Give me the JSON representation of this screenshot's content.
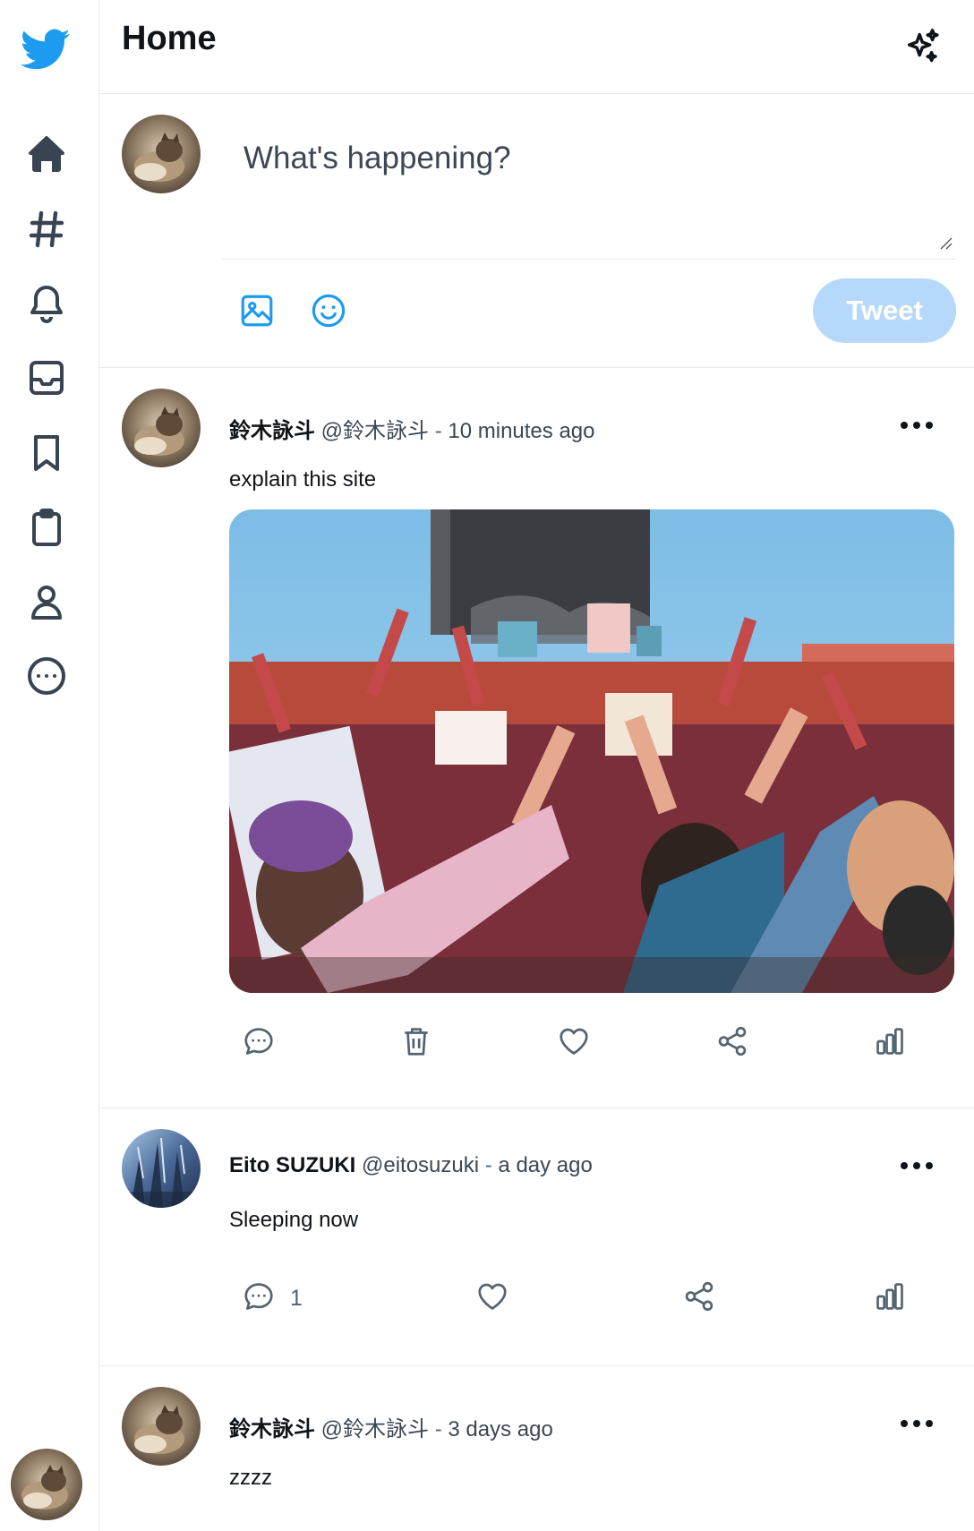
{
  "app": {
    "brand_color": "#1d9bf0",
    "icon_color": "#384452"
  },
  "sidebar": {
    "items": [
      {
        "name": "home",
        "icon": "home-icon"
      },
      {
        "name": "explore",
        "icon": "hashtag-icon"
      },
      {
        "name": "notifications",
        "icon": "bell-icon"
      },
      {
        "name": "messages",
        "icon": "inbox-icon"
      },
      {
        "name": "bookmarks",
        "icon": "bookmark-icon"
      },
      {
        "name": "lists",
        "icon": "clipboard-icon"
      },
      {
        "name": "profile",
        "icon": "user-icon"
      },
      {
        "name": "more",
        "icon": "more-circle-icon"
      }
    ]
  },
  "header": {
    "title": "Home"
  },
  "composer": {
    "placeholder": "What's happening?",
    "tweet_button": "Tweet"
  },
  "tweets": [
    {
      "name": "鈴木詠斗",
      "handle": "@鈴木詠斗",
      "time": "10 minutes ago",
      "text": "explain this site",
      "has_image": true
    },
    {
      "name": "Eito SUZUKI",
      "handle": "@eitosuzuki",
      "time": "a day ago",
      "text": "Sleeping now",
      "reply_count": "1"
    },
    {
      "name": "鈴木詠斗",
      "handle": "@鈴木詠斗",
      "time": "3 days ago",
      "text": "zzzz"
    }
  ],
  "separator": " - "
}
